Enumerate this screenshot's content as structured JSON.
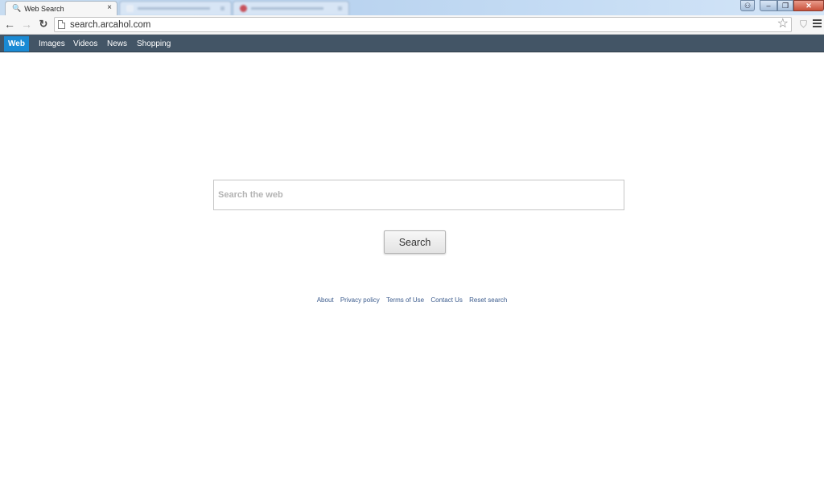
{
  "browser": {
    "active_tab": {
      "title": "Web Search",
      "close_icon": "×"
    },
    "background_tabs": [
      {
        "title": "",
        "blurred": true
      },
      {
        "title": "",
        "blurred": true
      }
    ],
    "window_controls": {
      "user": "⚇",
      "minimize": "–",
      "maximize": "❐",
      "close": "✕"
    },
    "nav": {
      "back": "←",
      "forward": "→",
      "reload": "↻"
    },
    "url": "search.arcahol.com",
    "bookmark_icon": "☆",
    "extension_icon": "⛉"
  },
  "site_nav": {
    "items": [
      {
        "label": "Web",
        "active": true
      },
      {
        "label": "Images",
        "active": false
      },
      {
        "label": "Videos",
        "active": false
      },
      {
        "label": "News",
        "active": false
      },
      {
        "label": "Shopping",
        "active": false
      }
    ]
  },
  "search": {
    "placeholder": "Search the web",
    "value": "",
    "button_label": "Search"
  },
  "footer": {
    "links": [
      "About",
      "Privacy policy",
      "Terms of Use",
      "Contact Us",
      "Reset search"
    ]
  },
  "colors": {
    "nav_bg": "#435566",
    "nav_active": "#1a8ad4",
    "link": "#3a5a8c"
  }
}
